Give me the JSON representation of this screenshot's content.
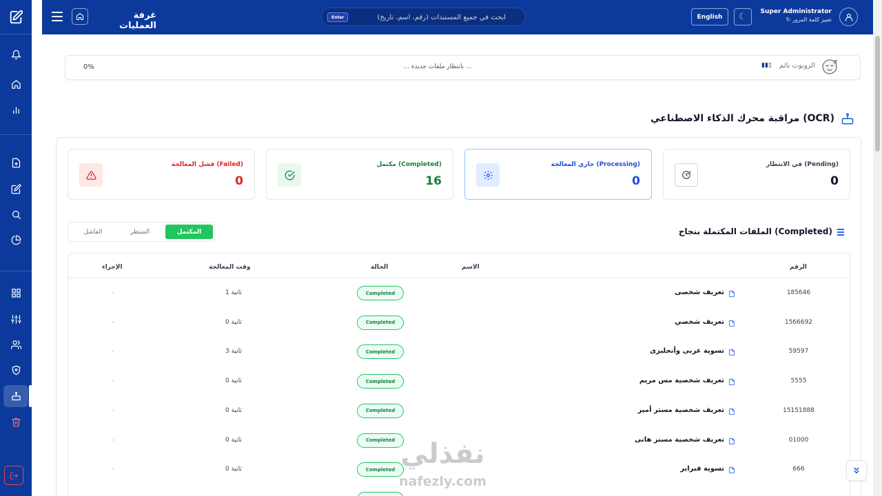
{
  "topbar": {
    "page_title": "غرفة العمليات",
    "search_placeholder": "ابحث في جميع المستندات (رقم، اسم، تاريخ)",
    "enter_badge": "Enter",
    "lang_button": "English",
    "user_name": "Super Administrator",
    "change_password": "تغيير كلمة المرور"
  },
  "robot": {
    "status_label": "الروبوت نائم",
    "waiting_text": "... بانتظار ملفات جديدة ...",
    "progress_text": "0%",
    "progress_fraction": 0
  },
  "section": {
    "title": "مراقبة محرك الذكاء الاصطناعي (OCR)"
  },
  "stats": {
    "pending": {
      "label": "في الانتظار (Pending)",
      "value": "0",
      "color": "#111827"
    },
    "processing": {
      "label": "جاري المعالجة (Processing)",
      "value": "0",
      "color": "#1d4ed8"
    },
    "completed": {
      "label": "مكتمل (Completed)",
      "value": "16",
      "color": "#15803d"
    },
    "failed": {
      "label": "فشل المعالجة (Failed)",
      "value": "0",
      "color": "#dc2626"
    }
  },
  "tabs": {
    "completed": "المكتمل",
    "pending": "المنتظر",
    "failed": "الفاشل"
  },
  "list": {
    "title": "الملفات المكتملة بنجاح (Completed)",
    "columns": {
      "number": "الرقم",
      "name": "الاسم",
      "status": "الحالة",
      "time": "وقت المعالجة",
      "action": "الإجراء"
    },
    "rows": [
      {
        "number": "185646",
        "name": "تعريف شخصى",
        "status": "Completed",
        "time": "1 ثانية",
        "action": "-"
      },
      {
        "number": "1566692",
        "name": "تعريف شخصي",
        "status": "Completed",
        "time": "0 ثانية",
        "action": "-"
      },
      {
        "number": "59597",
        "name": "تسوية عربى وأنجليزى",
        "status": "Completed",
        "time": "3 ثانية",
        "action": "-"
      },
      {
        "number": "5555",
        "name": "تعريف شخصية مس مريم",
        "status": "Completed",
        "time": "0 ثانية",
        "action": "-"
      },
      {
        "number": "15151888",
        "name": "تعريف شخصية مستر أمير",
        "status": "Completed",
        "time": "0 ثانية",
        "action": "-"
      },
      {
        "number": "01000",
        "name": "تعريف شخصية مستر هانى",
        "status": "Completed",
        "time": "0 ثانية",
        "action": "-"
      },
      {
        "number": "666",
        "name": "تسوية فبراير",
        "status": "Completed",
        "time": "0 ثانية",
        "action": "-"
      }
    ]
  },
  "watermark": {
    "arabic": "نفذلي",
    "latin": "nafezly.com"
  },
  "colors": {
    "primary": "#0b3a9c",
    "success": "#22c55e",
    "danger": "#dc2626",
    "info": "#1d4ed8"
  },
  "icons": {
    "rail": [
      "logo-icon",
      "bell-icon",
      "home-icon",
      "bar-chart-icon",
      "file-add-icon",
      "edit-icon",
      "search-icon",
      "pie-chart-icon",
      "grid-icon",
      "sliders-icon",
      "users-icon",
      "shield-icon",
      "robot-icon",
      "trash-icon",
      "logout-icon"
    ]
  }
}
